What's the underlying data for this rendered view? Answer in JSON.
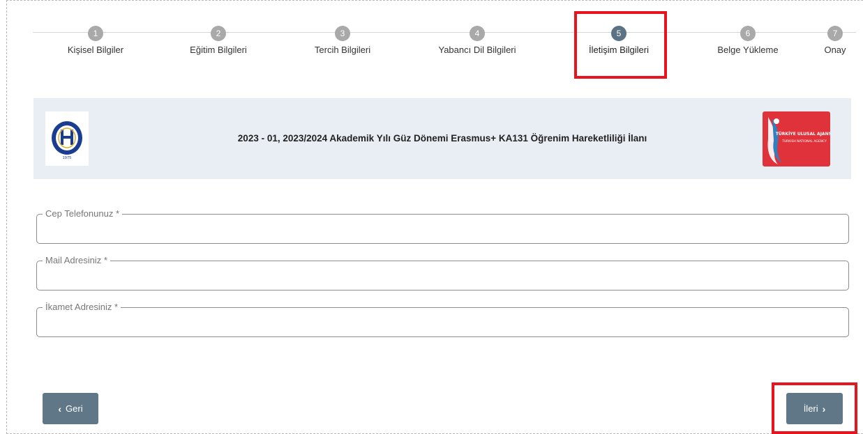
{
  "stepper": {
    "steps": [
      {
        "number": "1",
        "label": "Kişisel Bilgiler"
      },
      {
        "number": "2",
        "label": "Eğitim Bilgileri"
      },
      {
        "number": "3",
        "label": "Tercih Bilgileri"
      },
      {
        "number": "4",
        "label": "Yabancı Dil Bilgileri"
      },
      {
        "number": "5",
        "label": "İletişim Bilgileri"
      },
      {
        "number": "6",
        "label": "Belge Yükleme"
      },
      {
        "number": "7",
        "label": "Onay"
      }
    ],
    "active_step": 5
  },
  "banner": {
    "title": "2023 - 01, 2023/2024 Akademik Yılı Güz Dönemi Erasmus+ KA131 Öğrenim Hareketliliği İlanı",
    "right_logo_text": [
      "TÜRKİYE ULUSAL AJANSI",
      "TURKISH NATIONAL AGENCY"
    ]
  },
  "form": {
    "phone": {
      "label": "Cep Telefonunuz",
      "required_mark": "*",
      "value": ""
    },
    "email": {
      "label": "Mail Adresiniz",
      "required_mark": "*",
      "value": ""
    },
    "address": {
      "label": "İkamet Adresiniz",
      "required_mark": "*",
      "value": ""
    }
  },
  "buttons": {
    "back_label": "Geri",
    "next_label": "İleri"
  },
  "colors": {
    "active_step": "#5b7384",
    "inactive_step": "#a9a9a9",
    "highlight": "#e8141d",
    "button": "#5f7786",
    "banner_bg": "#e9eef5"
  }
}
